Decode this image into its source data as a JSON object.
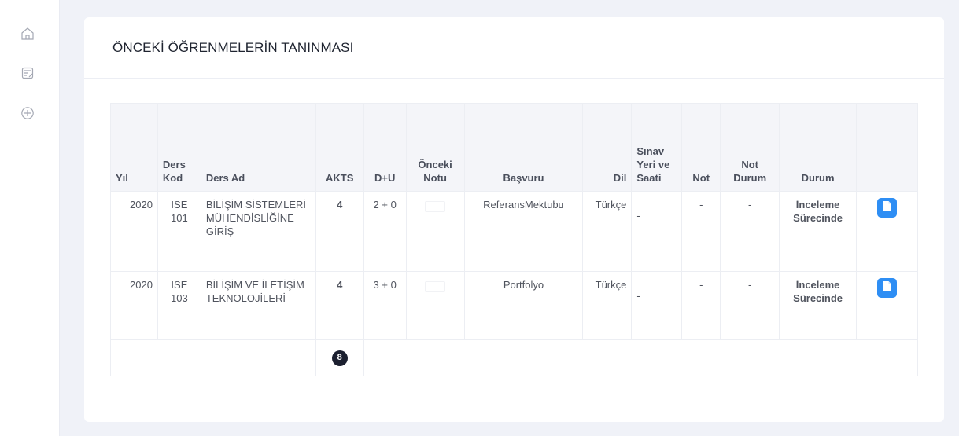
{
  "sidebar": {
    "icons": [
      "home-icon",
      "notes-icon",
      "add-circle-icon"
    ]
  },
  "page": {
    "title": "ÖNCEKİ ÖĞRENMELERİN TANINMASI"
  },
  "table": {
    "headers": {
      "yil": "Yıl",
      "ders_kod": "Ders Kod",
      "ders_ad": "Ders Ad",
      "akts": "AKTS",
      "du": "D+U",
      "onceki_notu": "Önceki Notu",
      "basvuru": "Başvuru",
      "dil": "Dil",
      "sinav": "Sınav Yeri ve Saati",
      "not": "Not",
      "not_durum": "Not Durum",
      "durum": "Durum"
    },
    "rows": [
      {
        "yil": "2020",
        "ders_kod": "ISE 101",
        "ders_ad": "BİLİŞİM SİSTEMLERİ MÜHENDİSLİĞİNE GİRİŞ",
        "akts": "4",
        "du": "2 + 0",
        "basvuru": "ReferansMektubu",
        "dil": "Türkçe",
        "sinav": "-",
        "not": "-",
        "not_durum": "-",
        "durum": "İnceleme Sürecinde"
      },
      {
        "yil": "2020",
        "ders_kod": "ISE 103",
        "ders_ad": "BİLİŞİM VE İLETİŞİM TEKNOLOJİLERİ",
        "akts": "4",
        "du": "3 + 0",
        "basvuru": "Portfolyo",
        "dil": "Türkçe",
        "sinav": "-",
        "not": "-",
        "not_durum": "-",
        "durum": "İnceleme Sürecinde"
      }
    ],
    "total_akts": "8"
  },
  "colors": {
    "accent": "#2e8ef4",
    "page_bg": "#f0f2f8",
    "badge": "#1c2030"
  }
}
